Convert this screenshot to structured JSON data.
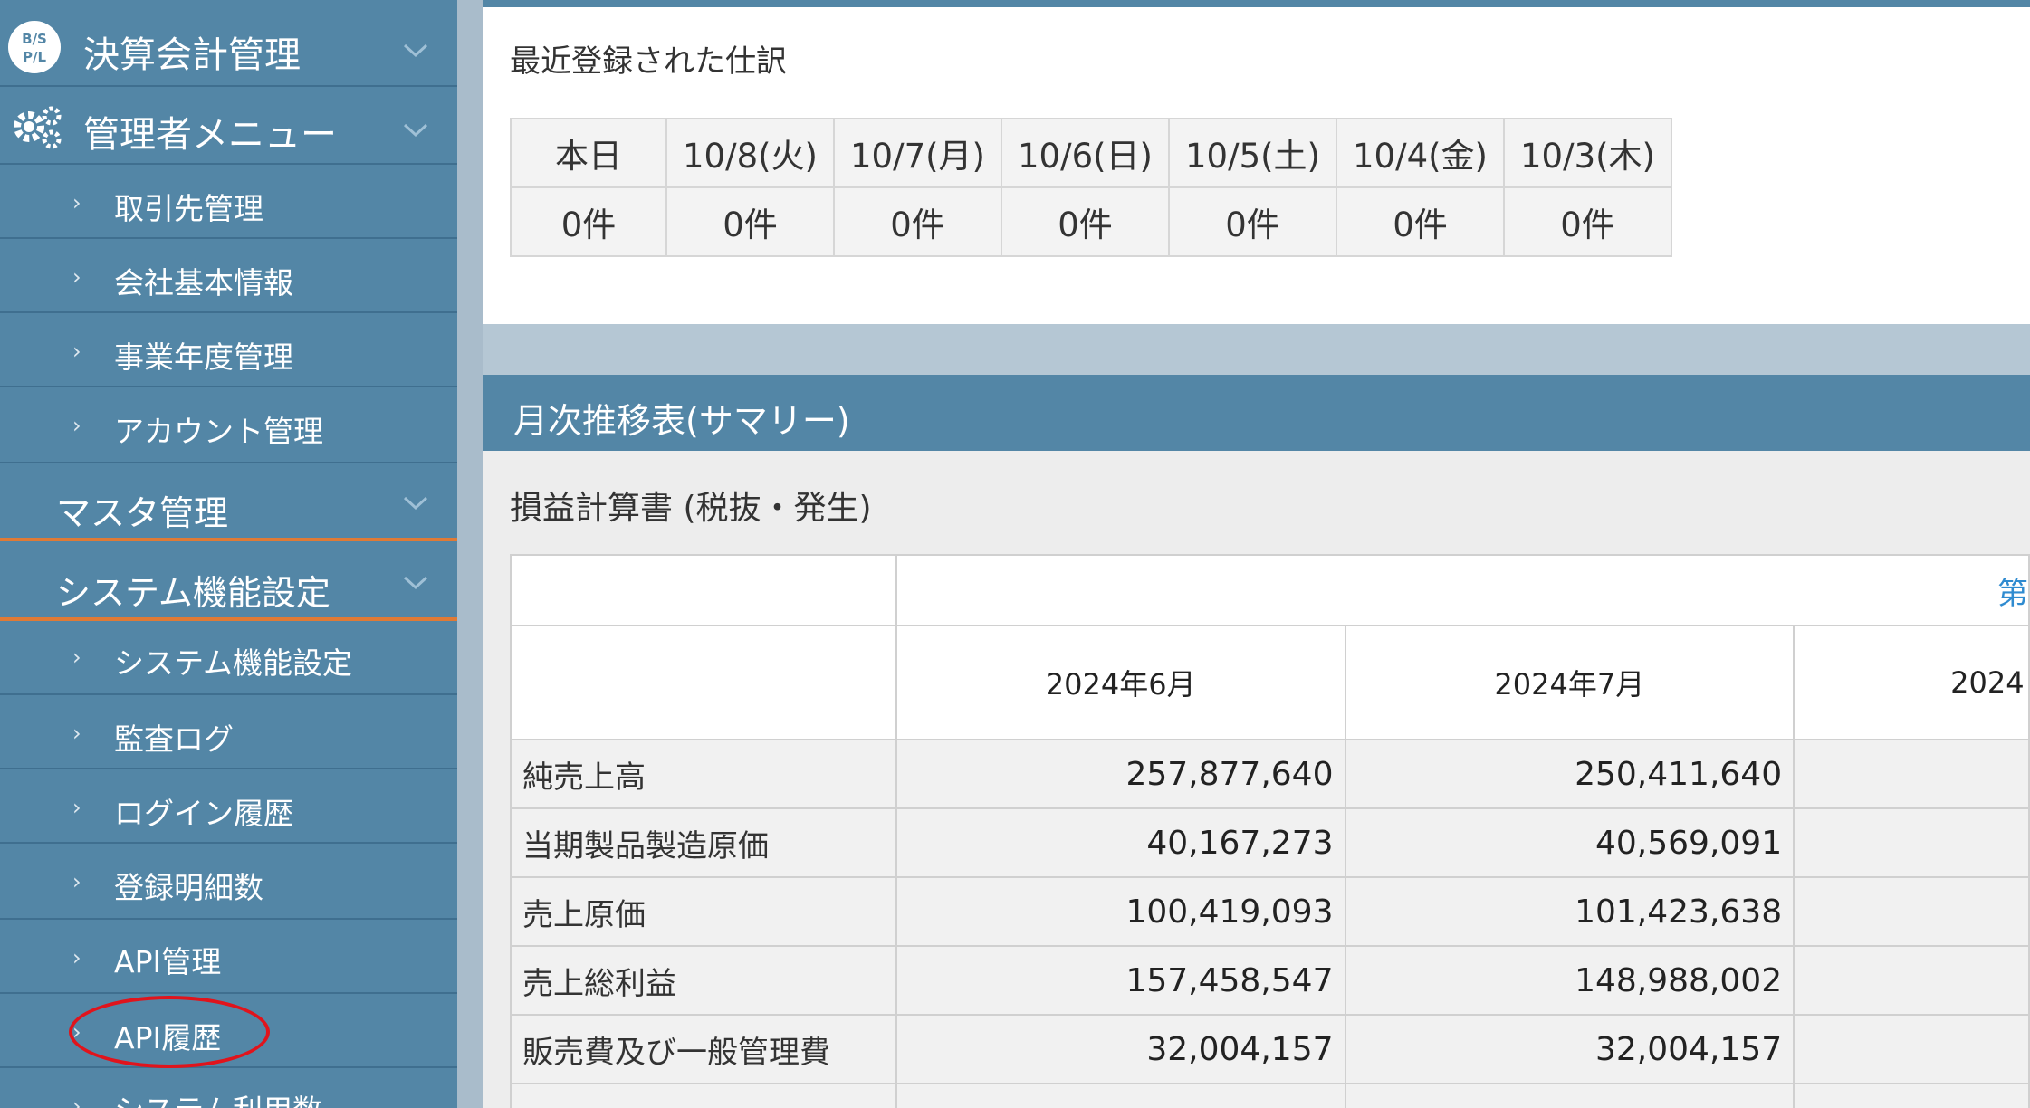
{
  "sidebar": {
    "items": [
      {
        "label": "決算会計管理",
        "icon": "bs-pl-icon"
      },
      {
        "label": "管理者メニュー",
        "icon": "gear-icon"
      },
      {
        "label": "取引先管理"
      },
      {
        "label": "会社基本情報"
      },
      {
        "label": "事業年度管理"
      },
      {
        "label": "アカウント管理"
      },
      {
        "label": "マスタ管理"
      },
      {
        "label": "システム機能設定"
      },
      {
        "label": "システム機能設定"
      },
      {
        "label": "監査ログ"
      },
      {
        "label": "ログイン履歴"
      },
      {
        "label": "登録明細数"
      },
      {
        "label": "API管理"
      },
      {
        "label": "API履歴",
        "highlighted": true
      },
      {
        "label": "システム利用数"
      }
    ],
    "bullet": "›",
    "bspl_logo_text": {
      "top": "B/S",
      "bottom": "P/L"
    }
  },
  "recent": {
    "title": "最近登録された仕訳",
    "headers": [
      "本日",
      "10/8(火)",
      "10/7(月)",
      "10/6(日)",
      "10/5(土)",
      "10/4(金)",
      "10/3(木)"
    ],
    "counts": [
      "0件",
      "0件",
      "0件",
      "0件",
      "0件",
      "0件",
      "0件"
    ]
  },
  "monthly": {
    "header": "月次推移表(サマリー)",
    "pl_title": "損益計算書 (税抜・発生)",
    "period_label": "第",
    "months": [
      "2024年6月",
      "2024年7月",
      "2024"
    ],
    "rows": [
      {
        "label": "純売上高",
        "values": [
          "257,877,640",
          "250,411,640"
        ]
      },
      {
        "label": "当期製品製造原価",
        "values": [
          "40,167,273",
          "40,569,091"
        ]
      },
      {
        "label": "売上原価",
        "values": [
          "100,419,093",
          "101,423,638"
        ]
      },
      {
        "label": "売上総利益",
        "values": [
          "157,458,547",
          "148,988,002"
        ]
      },
      {
        "label": "販売費及び一般管理費",
        "values": [
          "32,004,157",
          "32,004,157"
        ]
      }
    ]
  },
  "colors": {
    "sidebar_bg": "#5386a6",
    "accent_orange": "#e07a35",
    "highlight_red": "#e0141c",
    "link_blue": "#2f8bd0"
  }
}
